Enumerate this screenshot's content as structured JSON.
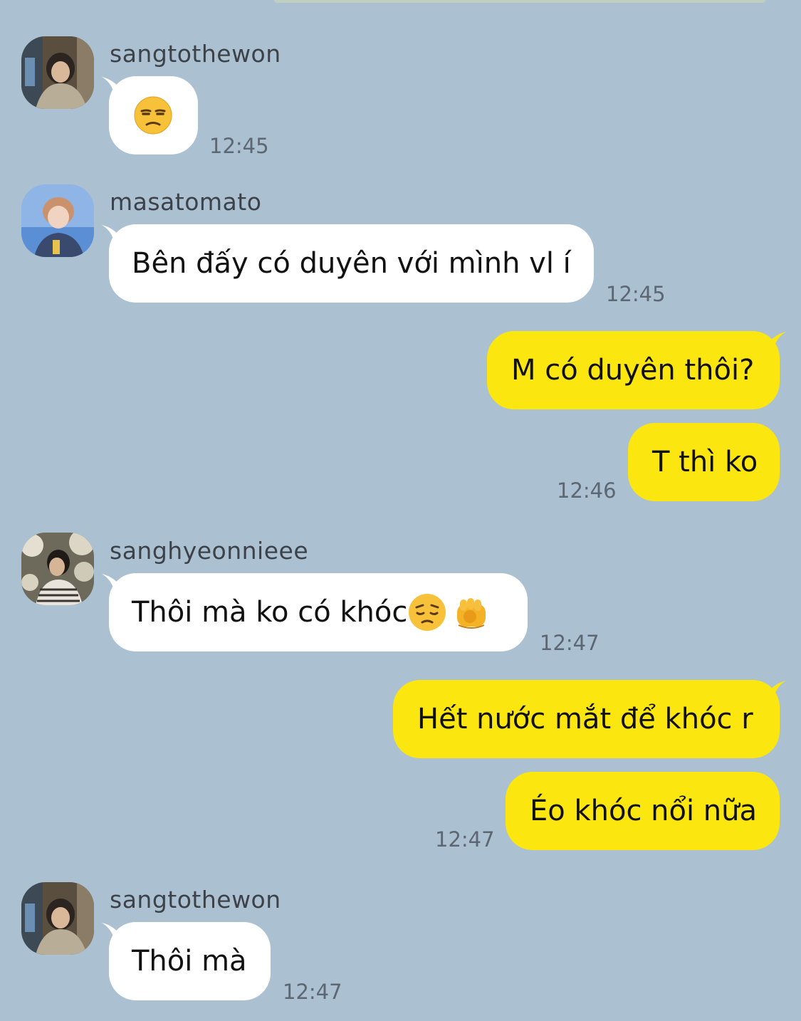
{
  "colors": {
    "background": "#abc1d2",
    "incoming_bubble": "#ffffff",
    "outgoing_bubble": "#fbe60f"
  },
  "messages": [
    {
      "sender": "sangtothewon",
      "text": "",
      "emoji": "unamused-face",
      "time": "12:45"
    },
    {
      "sender": "masatomato",
      "text": "Bên đấy có duyên với mình vl í",
      "time": "12:45"
    },
    {
      "text": "M có duyên thôi?"
    },
    {
      "text": "T thì ko",
      "time": "12:46"
    },
    {
      "sender": "sanghyeonnieee",
      "text": "Thôi mà ko có khóc",
      "emojis": [
        "pensive-face",
        "backhand-index-pointing-at-viewer"
      ],
      "time": "12:47"
    },
    {
      "text": "Hết nước mắt để khóc r"
    },
    {
      "text": "Éo khóc nổi nữa",
      "time": "12:47"
    },
    {
      "sender": "sangtothewon",
      "text": "Thôi mà",
      "time": "12:47"
    }
  ]
}
